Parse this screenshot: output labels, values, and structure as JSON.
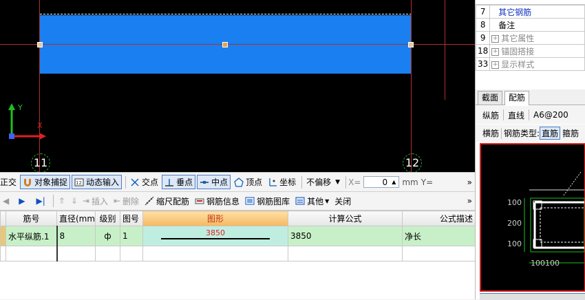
{
  "canvas": {
    "axis_left": "11",
    "axis_right": "12",
    "ucs_y": "Y",
    "ucs_x": "X"
  },
  "snap_toolbar": {
    "partial_left": "正交",
    "object_snap": "对象捕捉",
    "dynamic_input": "动态输入",
    "intersection": "交点",
    "perpendicular": "垂点",
    "midpoint": "中点",
    "vertex": "顶点",
    "coordinate": "坐标",
    "offset_select": "不偏移",
    "x_label": "X=",
    "x_value": "0",
    "unit_mm": "mm",
    "y_label": "Y=",
    "more": "»"
  },
  "rebar_toolbar": {
    "insert": "插入",
    "delete": "删除",
    "scale_rebar": "缩尺配筋",
    "rebar_info": "钢筋信息",
    "rebar_library": "钢筋图库",
    "other": "其他",
    "close": "关闭",
    "more": "»"
  },
  "rebar_table": {
    "headers": [
      "筋号",
      "直径(mm)",
      "级别",
      "图号",
      "图形",
      "计算公式",
      "公式描述"
    ],
    "rows": [
      {
        "name": "水平纵筋.1",
        "diameter": "8",
        "grade": "ф",
        "figure_no": "1",
        "shape_value": "3850",
        "formula": "3850",
        "description": "净长"
      }
    ]
  },
  "properties": {
    "rows": [
      {
        "no": "7",
        "expand": "",
        "name": "其它钢筋",
        "blue": true
      },
      {
        "no": "8",
        "expand": "",
        "name": "备注",
        "blue": false
      },
      {
        "no": "9",
        "expand": "+",
        "name": "其它属性",
        "blue": false
      },
      {
        "no": "18",
        "expand": "+",
        "name": "锚固搭接",
        "blue": false
      },
      {
        "no": "33",
        "expand": "+",
        "name": "显示样式",
        "blue": false
      }
    ]
  },
  "section_tabs": {
    "section": "截面",
    "rebar": "配筋"
  },
  "section_rebar": {
    "longitudinal_label": "纵筋",
    "line_type": "直线",
    "spec": "A6@200",
    "transverse_label": "横筋",
    "type_label": "钢筋类型:",
    "straight": "直筋",
    "stirrup_partial": "箍筋",
    "dim_100a": "100",
    "dim_200": "200",
    "dim_100b": "100",
    "dim_bottom": "100100"
  },
  "colors": {
    "beam_blue": "#1a7ff0",
    "grid_green": "#c8f0c8",
    "header_orange": "#f5b860"
  }
}
